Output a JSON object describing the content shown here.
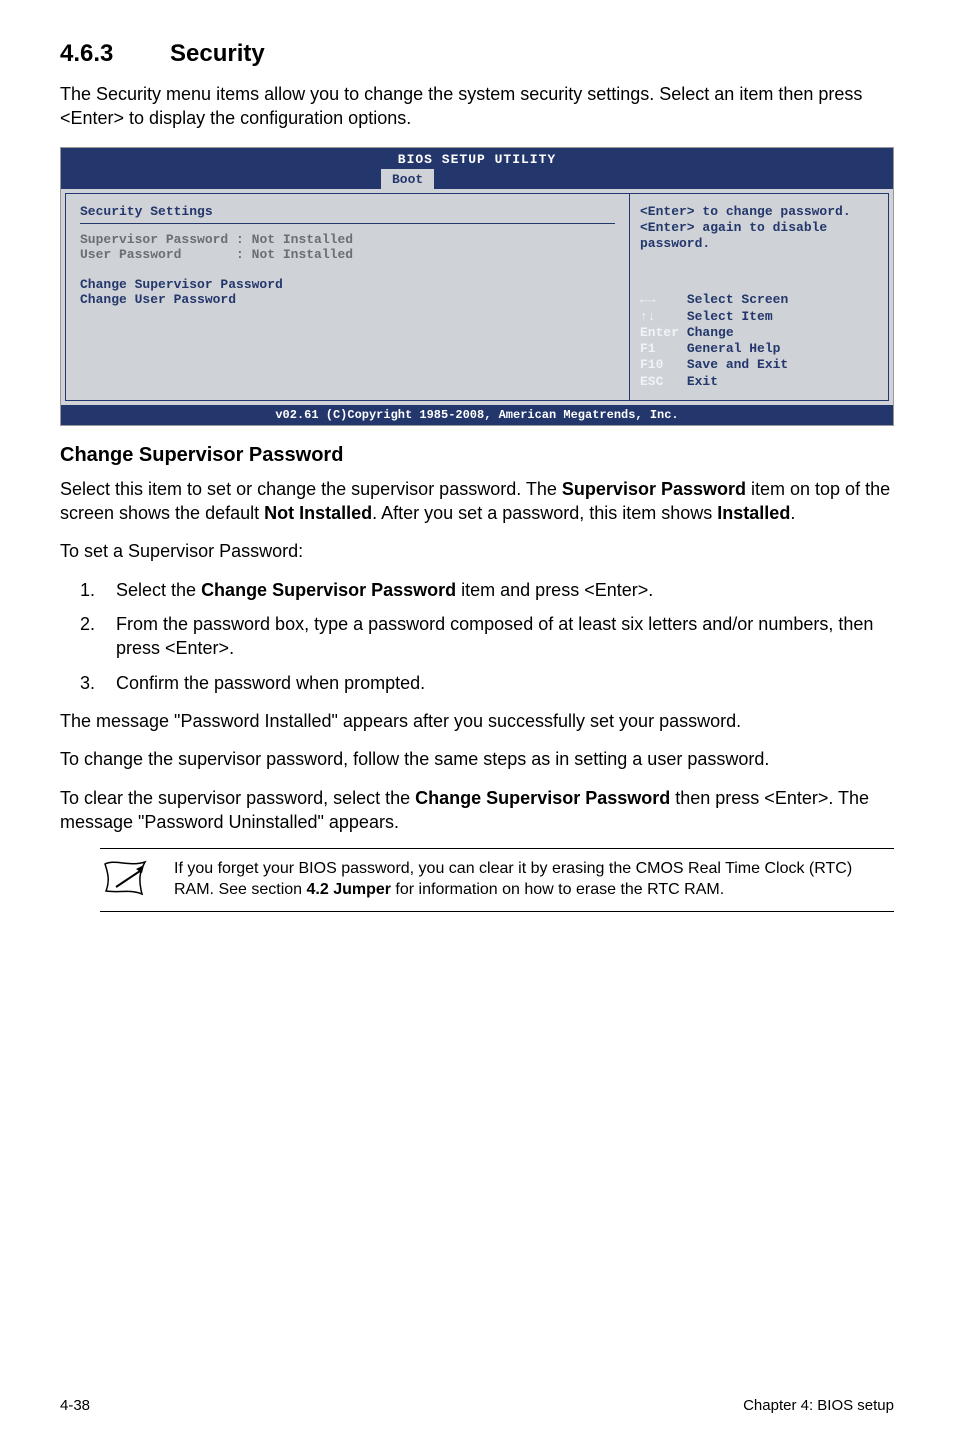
{
  "section": {
    "number": "4.6.3",
    "title": "Security"
  },
  "intro": "The Security menu items allow you to change the system security settings. Select an item then press <Enter> to display the configuration options.",
  "bios": {
    "title": "BIOS SETUP UTILITY",
    "tab": "Boot",
    "left": {
      "heading": "Security Settings",
      "sup_label": "Supervisor Password :",
      "sup_val": "Not Installed",
      "user_label": "User Password       :",
      "user_val": "Not Installed",
      "change_sup": "Change Supervisor Password",
      "change_user": "Change User Password"
    },
    "right": {
      "help1": "<Enter> to change password.",
      "help2": "<Enter> again to disable password.",
      "k_lr": "←→",
      "k_lr_t": "Select Screen",
      "k_ud": "↑↓",
      "k_ud_t": "Select Item",
      "k_en": "Enter",
      "k_en_t": "Change",
      "k_f1": "F1",
      "k_f1_t": "General Help",
      "k_f10": "F10",
      "k_f10_t": "Save and Exit",
      "k_esc": "ESC",
      "k_esc_t": "Exit"
    },
    "footer": "v02.61 (C)Copyright 1985-2008, American Megatrends, Inc."
  },
  "subhead": "Change Supervisor Password",
  "p1a": "Select this item to set or change the supervisor password. The ",
  "p1b": "Supervisor Password",
  "p1c": " item on top of the screen shows the default ",
  "p1d": "Not Installed",
  "p1e": ". After you set a password, this item shows ",
  "p1f": "Installed",
  "p1g": ".",
  "p2": "To set a Supervisor Password:",
  "steps": {
    "s1a": "Select the ",
    "s1b": "Change Supervisor Password",
    "s1c": " item and press <Enter>.",
    "s2": "From the password box, type a password composed of at least six letters and/or numbers, then press <Enter>.",
    "s3": "Confirm the password when prompted."
  },
  "p3": "The message \"Password Installed\" appears after you successfully set your password.",
  "p4": "To change the supervisor password, follow the same steps as in setting a user password.",
  "p5a": "To clear the supervisor password, select the ",
  "p5b": "Change Supervisor Password",
  "p5c": " then press <Enter>. The message \"Password Uninstalled\" appears.",
  "note_a": "If you forget your BIOS password, you can clear it by erasing the CMOS Real Time Clock (RTC) RAM. See section ",
  "note_b": "4.2 Jumper",
  "note_c": " for information on how to erase the RTC RAM.",
  "footer": {
    "left": "4-38",
    "right": "Chapter 4: BIOS setup"
  }
}
